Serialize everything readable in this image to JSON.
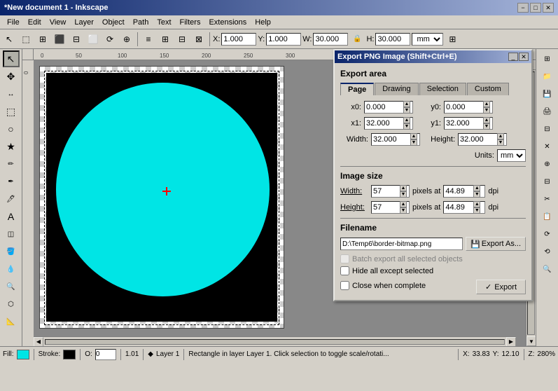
{
  "titlebar": {
    "title": "*New document 1 - Inkscape",
    "min": "−",
    "max": "□",
    "close": "✕"
  },
  "menubar": {
    "items": [
      "File",
      "Edit",
      "View",
      "Layer",
      "Object",
      "Path",
      "Text",
      "Filters",
      "Extensions",
      "Help"
    ]
  },
  "toolbar": {
    "x_label": "X:",
    "x_value": "1.000",
    "y_label": "Y:",
    "y_value": "1.000",
    "w_label": "W:",
    "w_value": "30.000",
    "h_label": "H:",
    "h_value": "30.000",
    "unit": "mm"
  },
  "tools": {
    "items": [
      "↖",
      "✥",
      "⬚",
      "◇",
      "✏",
      "✒",
      "🖊",
      "A",
      "★",
      "◎",
      "🪣",
      "💧",
      "🔍",
      "⬡",
      "📐",
      "🖐"
    ]
  },
  "export_dialog": {
    "title": "Export PNG Image (Shift+Ctrl+E)",
    "section_area": "Export area",
    "tab_page": "Page",
    "tab_drawing": "Drawing",
    "tab_selection": "Selection",
    "tab_custom": "Custom",
    "x0_label": "x0:",
    "x0_value": "0.000",
    "y0_label": "y0:",
    "y0_value": "0.000",
    "x1_label": "x1:",
    "x1_value": "32.000",
    "y1_label": "y1:",
    "y1_value": "32.000",
    "width_label": "Width:",
    "width_value": "32.000",
    "height_label": "Height:",
    "height_value": "32.000",
    "units_label": "Units:",
    "units_value": "mm",
    "image_size_title": "Image size",
    "img_width_label": "Width:",
    "img_width_value": "57",
    "img_pixels_at1": "pixels at",
    "img_dpi1": "44.89",
    "img_dpi_label1": "dpi",
    "img_height_label": "Height:",
    "img_height_value": "57",
    "img_pixels_at2": "pixels at",
    "img_dpi2": "44.89",
    "img_dpi_label2": "dpi",
    "filename_title": "Filename",
    "filename_value": "D:\\Temp6\\border-bitmap.png",
    "export_as_label": "Export As...",
    "batch_export_label": "Batch export all selected objects",
    "hide_except_label": "Hide all except selected",
    "close_when_label": "Close when complete",
    "export_btn": "Export"
  },
  "statusbar": {
    "fill_label": "Fill:",
    "stroke_label": "Stroke:",
    "stroke_value": "1.01",
    "opacity_label": "O:",
    "opacity_value": "0",
    "layer_label": "Layer 1",
    "status_text": "Rectangle in layer Layer 1. Click selection to toggle scale/rotati...",
    "x_coord": "33.83",
    "y_coord": "12.10",
    "x_label": "X:",
    "y_label": "Y:",
    "zoom_label": "Z:",
    "zoom_value": "280%"
  }
}
